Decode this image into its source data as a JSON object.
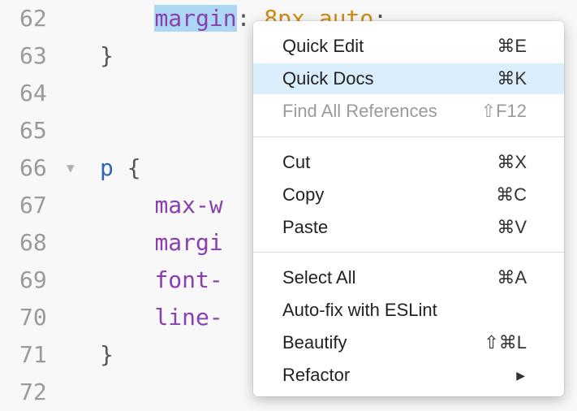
{
  "editor": {
    "lines": [
      {
        "num": "62",
        "code": [
          {
            "t": "    ",
            "c": "kw-plain"
          },
          {
            "t": "margin",
            "c": "kw-purple sel"
          },
          {
            "t": ": ",
            "c": "kw-plain"
          },
          {
            "t": "8px auto",
            "c": "kw-orange"
          },
          {
            "t": ";",
            "c": "kw-plain"
          }
        ]
      },
      {
        "num": "63",
        "code": [
          {
            "t": "}",
            "c": "kw-plain"
          }
        ]
      },
      {
        "num": "64",
        "code": []
      },
      {
        "num": "65",
        "code": []
      },
      {
        "num": "66",
        "fold": "▼",
        "code": [
          {
            "t": "p",
            "c": "kw-blue"
          },
          {
            "t": " {",
            "c": "kw-plain"
          }
        ]
      },
      {
        "num": "67",
        "code": [
          {
            "t": "    ",
            "c": "kw-plain"
          },
          {
            "t": "max-w",
            "c": "kw-purple"
          }
        ]
      },
      {
        "num": "68",
        "code": [
          {
            "t": "    ",
            "c": "kw-plain"
          },
          {
            "t": "margi",
            "c": "kw-purple"
          }
        ]
      },
      {
        "num": "69",
        "code": [
          {
            "t": "    ",
            "c": "kw-plain"
          },
          {
            "t": "font-",
            "c": "kw-purple"
          }
        ]
      },
      {
        "num": "70",
        "code": [
          {
            "t": "    ",
            "c": "kw-plain"
          },
          {
            "t": "line-",
            "c": "kw-purple"
          }
        ]
      },
      {
        "num": "71",
        "code": [
          {
            "t": "}",
            "c": "kw-plain"
          }
        ]
      },
      {
        "num": "72",
        "code": []
      }
    ]
  },
  "context_menu": {
    "items": [
      {
        "label": "Quick Edit",
        "shortcut": "⌘E",
        "name": "menu-item-quick-edit"
      },
      {
        "label": "Quick Docs",
        "shortcut": "⌘K",
        "name": "menu-item-quick-docs",
        "highlighted": true
      },
      {
        "label": "Find All References",
        "shortcut": "⇧F12",
        "name": "menu-item-find-all-references",
        "disabled": true
      },
      {
        "label": "Cut",
        "shortcut": "⌘X",
        "name": "menu-item-cut"
      },
      {
        "label": "Copy",
        "shortcut": "⌘C",
        "name": "menu-item-copy"
      },
      {
        "label": "Paste",
        "shortcut": "⌘V",
        "name": "menu-item-paste"
      },
      {
        "label": "Select All",
        "shortcut": "⌘A",
        "name": "menu-item-select-all"
      },
      {
        "label": "Auto-fix with ESLint",
        "shortcut": "",
        "name": "menu-item-auto-fix-eslint"
      },
      {
        "label": "Beautify",
        "shortcut": "⇧⌘L",
        "name": "menu-item-beautify"
      },
      {
        "label": "Refactor",
        "shortcut": "",
        "name": "menu-item-refactor",
        "submenu": "submenu-arrow-icon"
      }
    ]
  },
  "colors": {
    "editor_background": "#f8f8f8",
    "selection": "#add8f5",
    "menu_highlight": "#dbeefb",
    "property": "#8a3fb0",
    "selector": "#2f62b8",
    "value": "#d28a13"
  }
}
